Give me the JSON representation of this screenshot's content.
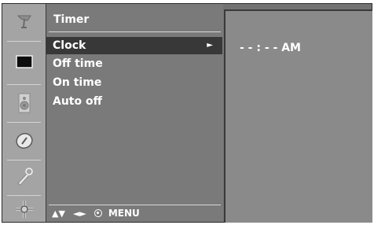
{
  "menu": {
    "title": "Timer",
    "items": [
      {
        "label": "Clock",
        "selected": true,
        "arrow": "►"
      },
      {
        "label": "Off time",
        "selected": false
      },
      {
        "label": "On time",
        "selected": false
      },
      {
        "label": "Auto off",
        "selected": false
      }
    ],
    "nav": {
      "updown": "▲▼",
      "leftright": "◄►",
      "menu_label": "MENU"
    }
  },
  "sidebar": {
    "icons": [
      "antenna-icon",
      "picture-icon",
      "speaker-icon",
      "clock-icon",
      "key-icon",
      "settings-icon"
    ]
  },
  "clock": {
    "value": "- - : - - AM"
  },
  "colors": {
    "sidebar_bg": "#a4a4a4",
    "panel_bg": "#7a7a7a",
    "selected_bg": "#383838",
    "sub_bg": "#8a8a8a"
  }
}
